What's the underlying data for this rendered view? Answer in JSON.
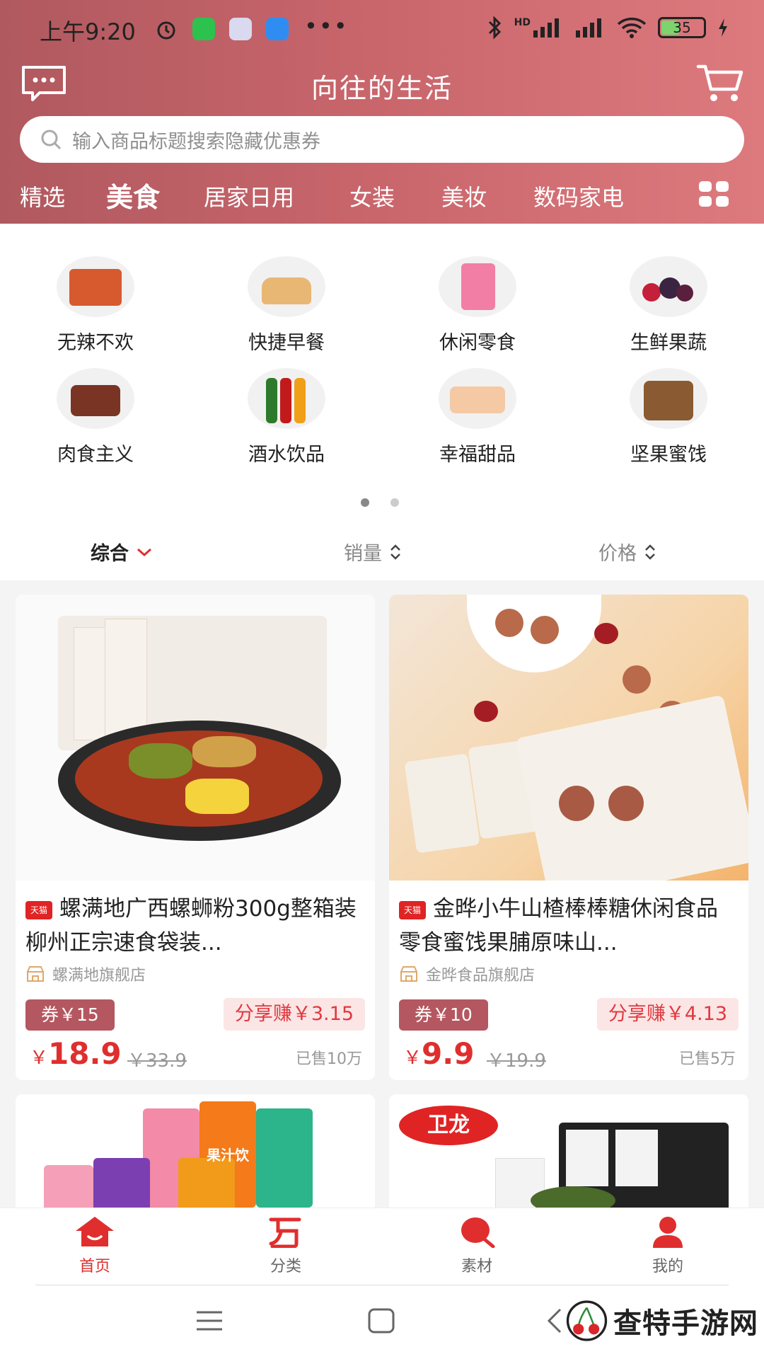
{
  "status_bar": {
    "time": "上午9:20",
    "network": "HD",
    "battery": "35"
  },
  "header": {
    "title": "向往的生活",
    "search_placeholder": "输入商品标题搜索隐藏优惠券"
  },
  "tabs": [
    {
      "label": "精选",
      "active": false
    },
    {
      "label": "美食",
      "active": true
    },
    {
      "label": "居家日用",
      "active": false
    },
    {
      "label": "女装",
      "active": false
    },
    {
      "label": "美妆",
      "active": false
    },
    {
      "label": "数码家电",
      "active": false
    }
  ],
  "categories": [
    {
      "label": "无辣不欢"
    },
    {
      "label": "快捷早餐"
    },
    {
      "label": "休闲零食"
    },
    {
      "label": "生鲜果蔬"
    },
    {
      "label": "肉食主义"
    },
    {
      "label": "酒水饮品"
    },
    {
      "label": "幸福甜品"
    },
    {
      "label": "坚果蜜饯"
    }
  ],
  "sort": {
    "comprehensive": "综合",
    "sales": "销量",
    "price": "价格"
  },
  "products": [
    {
      "badge": "天猫",
      "title": "螺满地广西螺蛳粉300g整箱装 柳州正宗速食袋装...",
      "shop": "螺满地旗舰店",
      "coupon": "券￥15",
      "share": "分享赚￥3.15",
      "currency": "￥",
      "price": "18.9",
      "original": "￥33.9",
      "sold": "已售10万"
    },
    {
      "badge": "天猫",
      "title": "金晔小牛山楂棒棒糖休闲食品零食蜜饯果脯原味山...",
      "shop": "金晔食品旗舰店",
      "coupon": "券￥10",
      "share": "分享赚￥4.13",
      "currency": "￥",
      "price": "9.9",
      "original": "￥19.9",
      "sold": "已售5万"
    }
  ],
  "partial_cards": [
    {
      "brand_text": "果汁饮"
    },
    {
      "brand_text": "卫龙"
    }
  ],
  "bottom_nav": [
    {
      "label": "首页",
      "active": true
    },
    {
      "label": "分类",
      "active": false
    },
    {
      "label": "素材",
      "active": false
    },
    {
      "label": "我的",
      "active": false
    }
  ],
  "watermark": "查特手游网",
  "colors": {
    "accent": "#e02e2e",
    "header_start": "#b0595f",
    "header_end": "#dd7a7e"
  }
}
